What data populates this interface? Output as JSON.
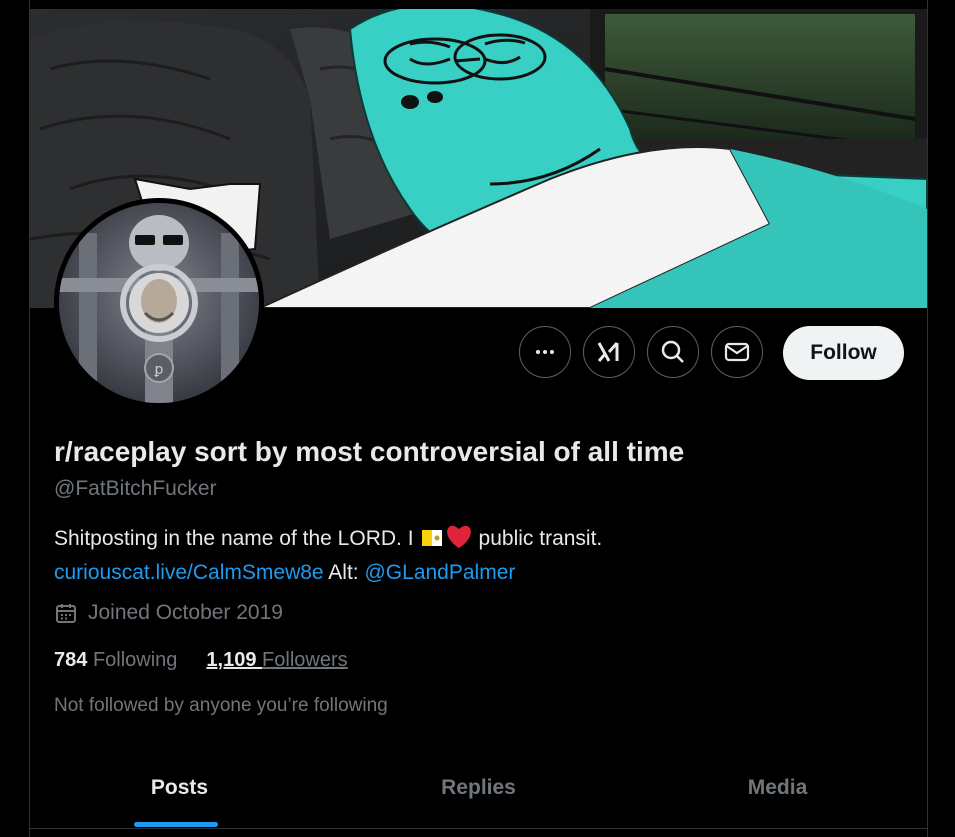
{
  "profile": {
    "display_name": "r/raceplay sort by most controversial of all time",
    "handle": "@FatBitchFucker",
    "bio_text": "Shitposting in the name of the LORD. I",
    "bio_text_2": "public transit.",
    "bio_link": "curiouscat.live/CalmSmew8e",
    "bio_alt_label": "Alt:",
    "bio_alt_handle": "@GLandPalmer",
    "joined": "Joined October 2019",
    "following_count": "784",
    "following_label": "Following",
    "followers_count": "1,109",
    "followers_label": "Followers",
    "not_followed_text": "Not followed by anyone you’re following"
  },
  "actions": {
    "more_icon": "more-dots-icon",
    "grok_icon": "grok-icon",
    "search_icon": "search-icon",
    "message_icon": "envelope-icon",
    "follow_label": "Follow"
  },
  "tabs": [
    {
      "label": "Posts",
      "active": true
    },
    {
      "label": "Replies",
      "active": false
    },
    {
      "label": "Media",
      "active": false
    }
  ],
  "colors": {
    "accent": "#1d9bf0",
    "background": "#000000",
    "text_primary": "#e7e9ea",
    "text_secondary": "#71767b",
    "border": "#2f3336",
    "banner_character": "#38cfc4"
  }
}
